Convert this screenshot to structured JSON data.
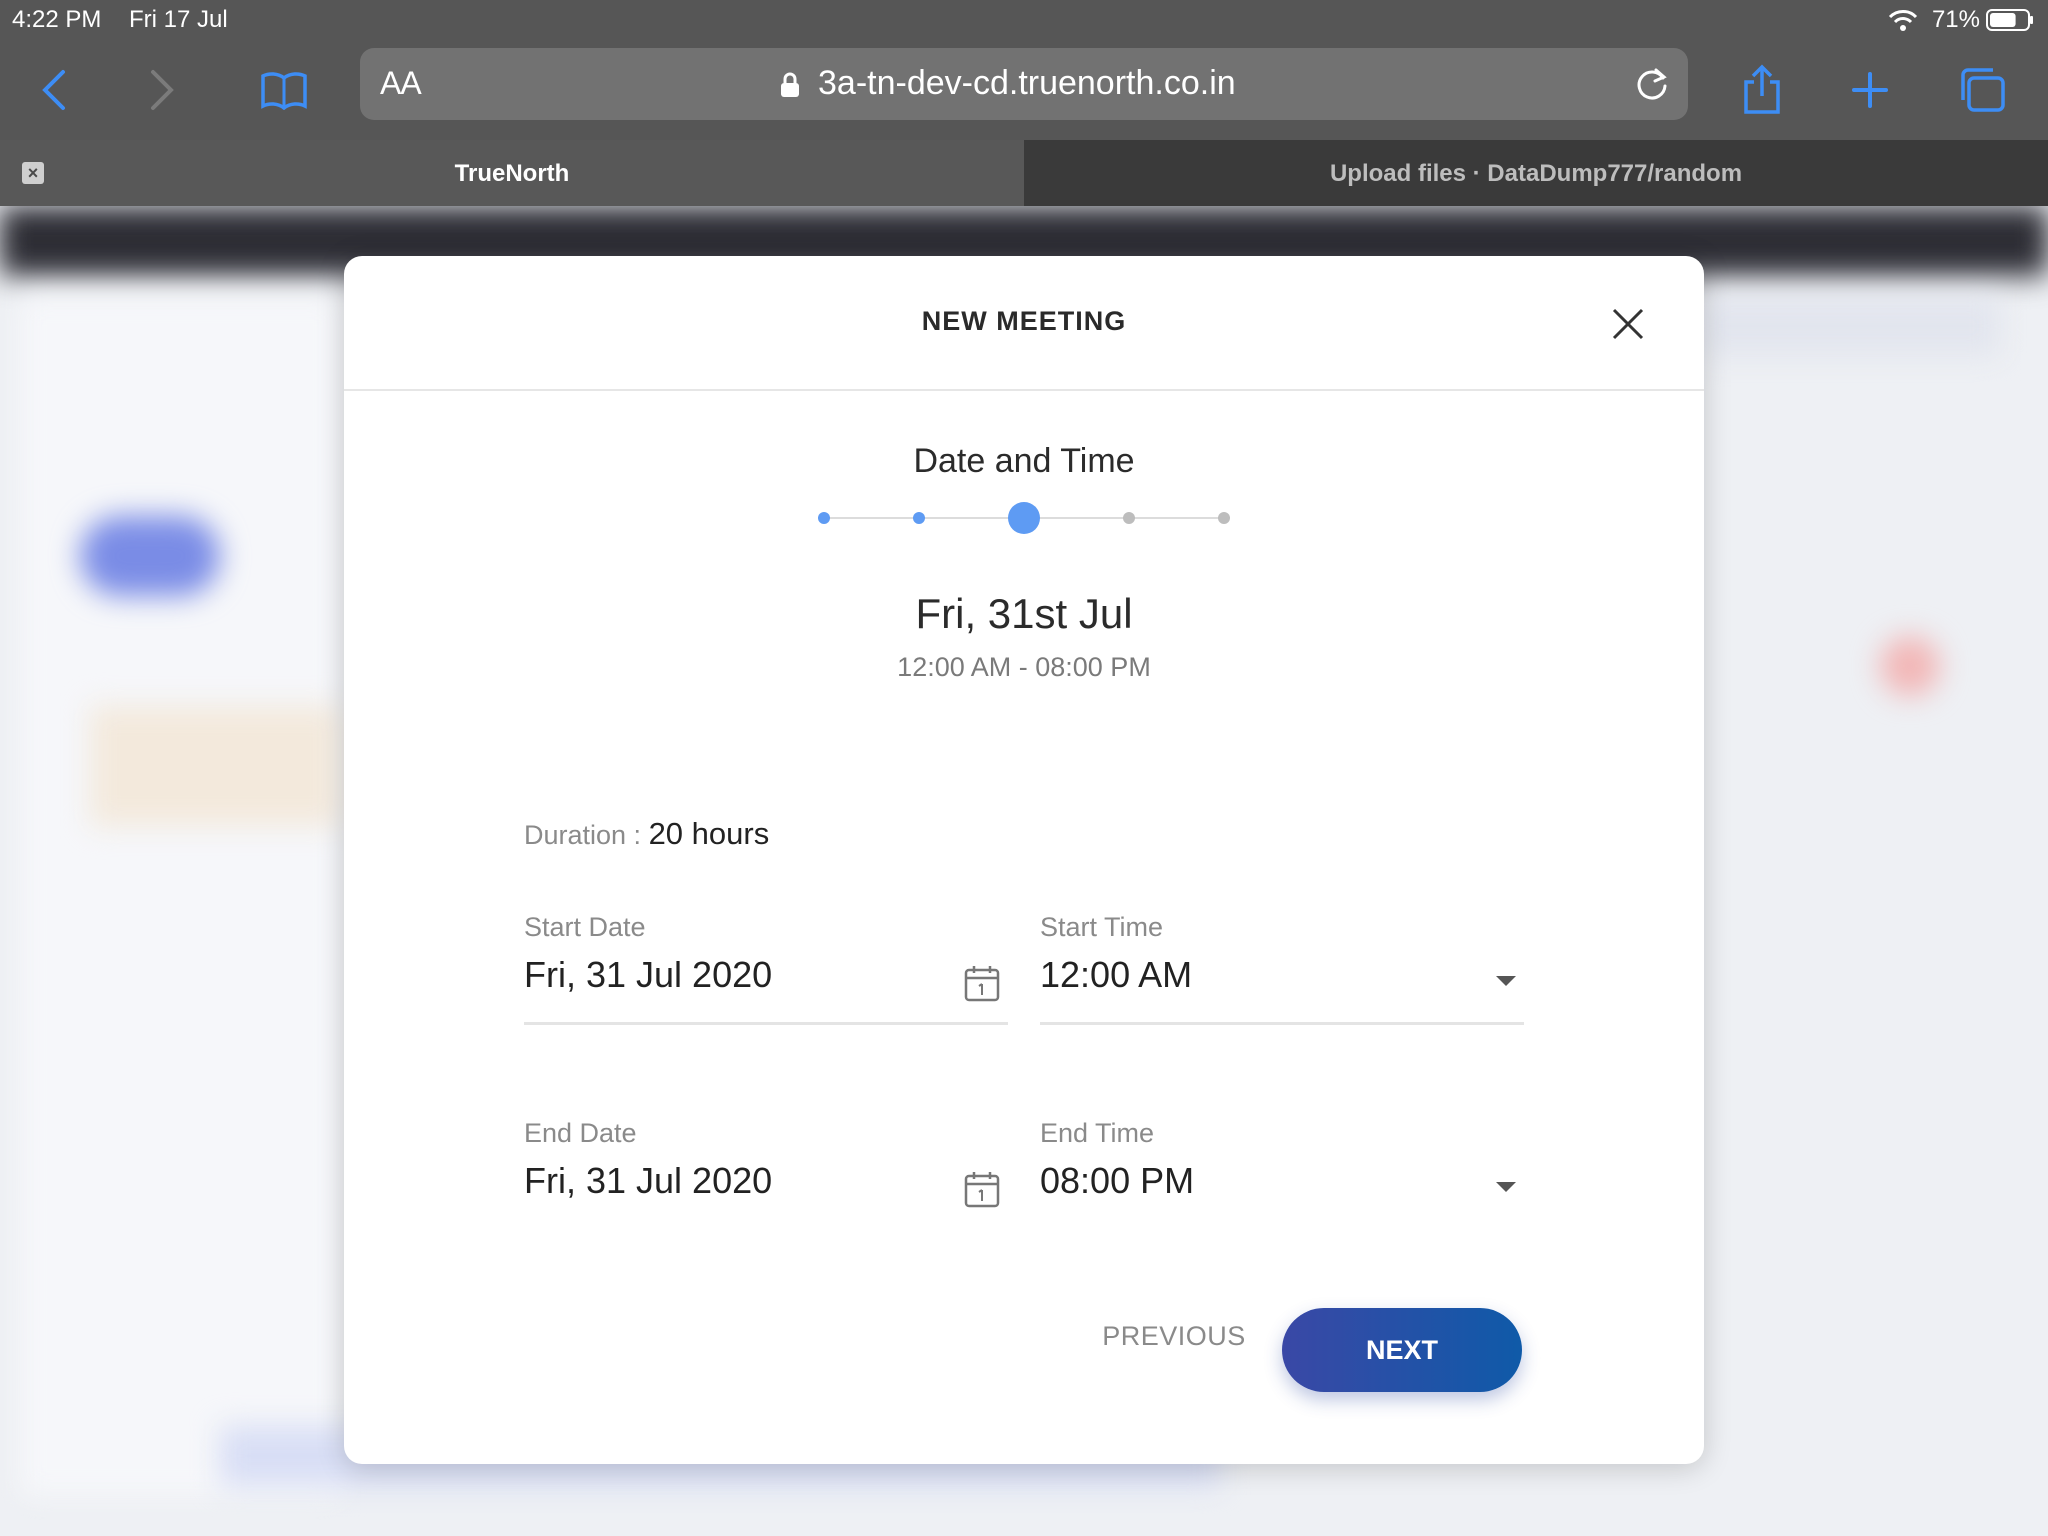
{
  "status_bar": {
    "time": "4:22 PM",
    "date": "Fri 17 Jul",
    "battery": "71%",
    "battery_level": 0.71
  },
  "browser": {
    "text_size_label": "AA",
    "url": "3a-tn-dev-cd.truenorth.co.in",
    "icons": [
      "back-icon",
      "forward-icon",
      "bookmarks-icon",
      "lock-icon",
      "reload-icon",
      "share-icon",
      "new-tab-icon",
      "tabs-icon"
    ],
    "accent_color": "#3d8df5",
    "tabs": [
      {
        "title": "TrueNorth",
        "active": true
      },
      {
        "title": "Upload files · DataDump777/random",
        "active": false
      }
    ]
  },
  "modal": {
    "title": "NEW MEETING",
    "step_title": "Date and Time",
    "stepper": {
      "total_steps": 5,
      "current_step": 3
    },
    "selected_date": "Fri, 31st Jul",
    "time_range": "12:00 AM - 08:00 PM",
    "duration_label": "Duration : ",
    "duration_value": "20 hours",
    "start_date": {
      "label": "Start Date",
      "value": "Fri, 31 Jul 2020"
    },
    "start_time": {
      "label": "Start Time",
      "value": "12:00 AM"
    },
    "end_date": {
      "label": "End Date",
      "value": "Fri, 31 Jul 2020"
    },
    "end_time": {
      "label": "End Time",
      "value": "08:00 PM"
    },
    "previous_label": "PREVIOUS",
    "next_label": "NEXT",
    "colors": {
      "step_active": "#5e9bf3",
      "step_inactive": "#bdbdbd",
      "next_start": "#3a48a6",
      "next_end": "#0f5aa8"
    }
  }
}
